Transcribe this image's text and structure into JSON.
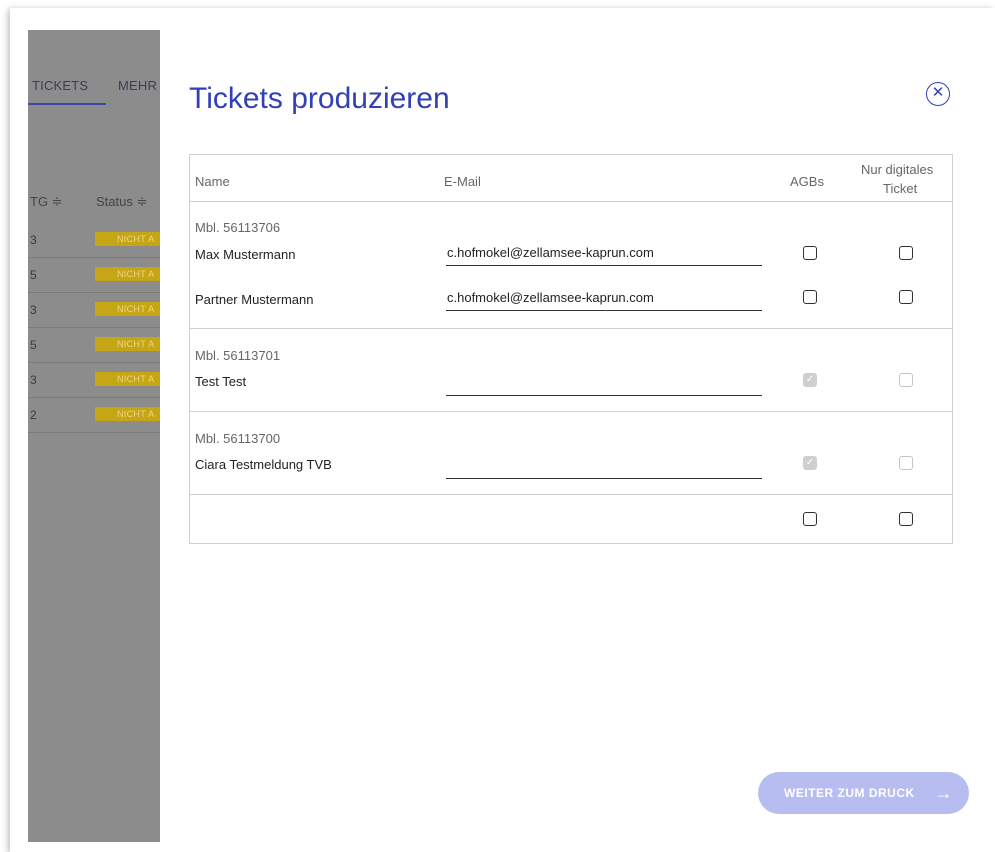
{
  "background": {
    "tabs": [
      {
        "label": "TICKETS"
      },
      {
        "label": "MEHR"
      }
    ],
    "headers": {
      "tg": "TG ≑",
      "status": "Status ≑"
    },
    "rows": [
      {
        "num": "3",
        "badge": "NICHT A"
      },
      {
        "num": "5",
        "badge": "NICHT A"
      },
      {
        "num": "3",
        "badge": "NICHT A"
      },
      {
        "num": "5",
        "badge": "NICHT A"
      },
      {
        "num": "3",
        "badge": "NICHT A"
      },
      {
        "num": "2",
        "badge": "NICHT A"
      }
    ]
  },
  "modal": {
    "title": "Tickets produzieren",
    "close_icon": "close-circle-icon",
    "columns": {
      "name": "Name",
      "email": "E-Mail",
      "agbs": "AGBs",
      "digital_line1": "Nur digitales",
      "digital_line2": "Ticket"
    },
    "groups": [
      {
        "mbl": "Mbl. 56113706",
        "persons": [
          {
            "name": "Max Mustermann",
            "email": "c.hofmokel@zellamsee-kaprun.com",
            "agb": false,
            "digital": false
          },
          {
            "name": "Partner Mustermann",
            "email": "c.hofmokel@zellamsee-kaprun.com",
            "agb": false,
            "digital": false
          }
        ]
      },
      {
        "mbl": "Mbl. 56113701",
        "persons": [
          {
            "name": "Test Test",
            "email": "",
            "agb": true,
            "digital": false
          }
        ]
      },
      {
        "mbl": "Mbl. 56113700",
        "persons": [
          {
            "name": "Ciara Testmeldung TVB",
            "email": "",
            "agb": true,
            "digital": false
          }
        ]
      }
    ],
    "footer_row": {
      "agb": false,
      "digital": false
    },
    "print_button": {
      "label": "WEITER ZUM DRUCK",
      "arrow": "→"
    }
  },
  "colors": {
    "accent": "#3140b5",
    "button_disabled": "#b8bdf1",
    "badge": "#c7a615",
    "overlay": "#8c8c8c"
  }
}
